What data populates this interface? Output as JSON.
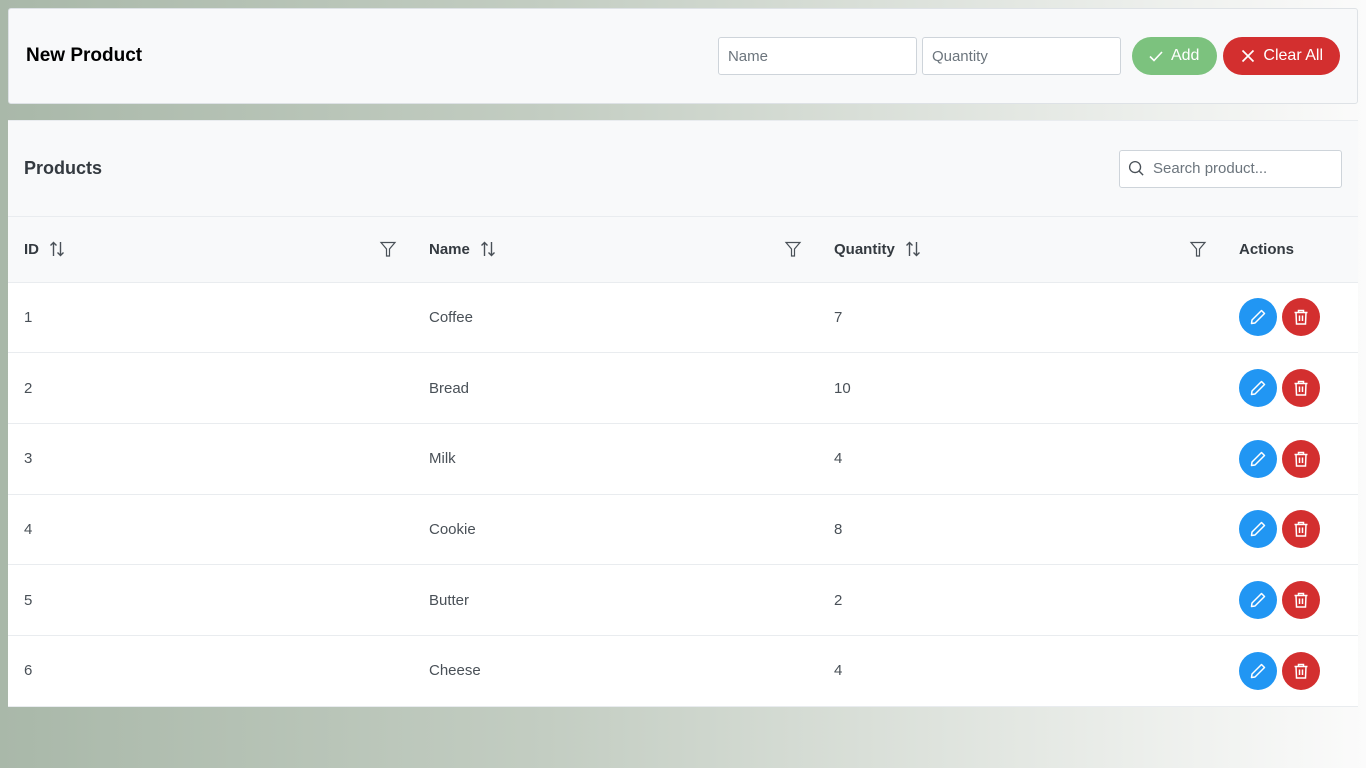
{
  "new_product": {
    "title": "New Product",
    "name_placeholder": "Name",
    "name_value": "",
    "quantity_placeholder": "Quantity",
    "quantity_value": "",
    "add_label": "Add",
    "add_icon": "check-icon",
    "clear_label": "Clear All",
    "clear_icon": "times-icon"
  },
  "products": {
    "title": "Products",
    "search_placeholder": "Search product...",
    "search_value": "",
    "columns": [
      {
        "label": "ID",
        "sortable": true,
        "filterable": true
      },
      {
        "label": "Name",
        "sortable": true,
        "filterable": true
      },
      {
        "label": "Quantity",
        "sortable": true,
        "filterable": true
      },
      {
        "label": "Actions",
        "sortable": false,
        "filterable": false
      }
    ],
    "rows": [
      {
        "id": "1",
        "name": "Coffee",
        "quantity": "7"
      },
      {
        "id": "2",
        "name": "Bread",
        "quantity": "10"
      },
      {
        "id": "3",
        "name": "Milk",
        "quantity": "4"
      },
      {
        "id": "4",
        "name": "Cookie",
        "quantity": "8"
      },
      {
        "id": "5",
        "name": "Butter",
        "quantity": "2"
      },
      {
        "id": "6",
        "name": "Cheese",
        "quantity": "4"
      }
    ]
  },
  "colors": {
    "add_button": "#7cc27e",
    "clear_button": "#d32f2f",
    "edit_button": "#2196f3",
    "delete_button": "#d32f2f"
  }
}
